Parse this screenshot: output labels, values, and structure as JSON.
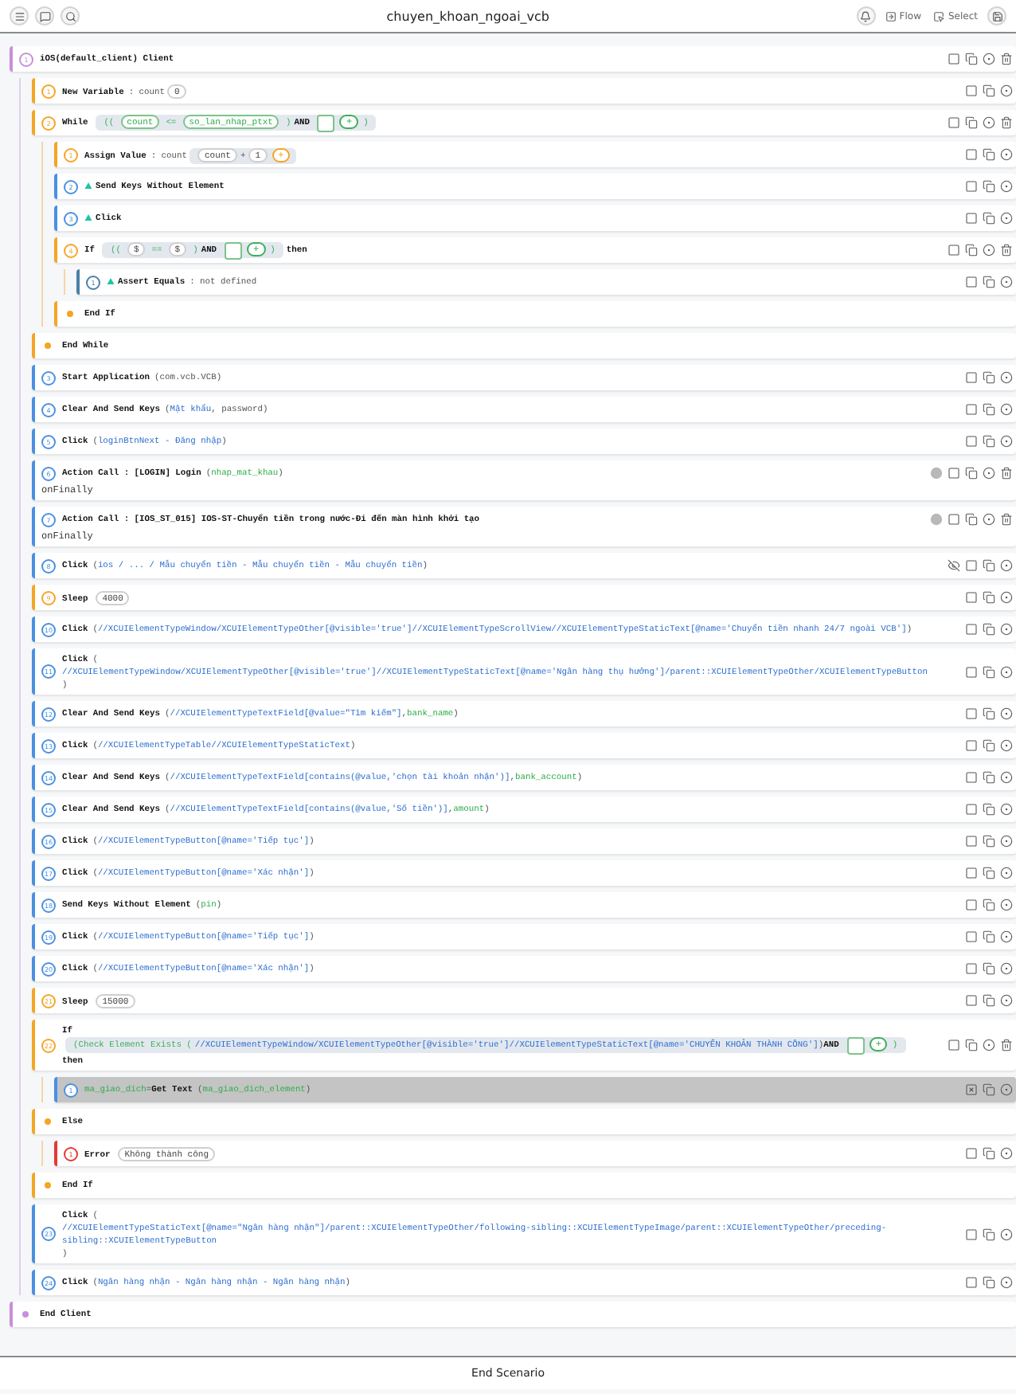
{
  "header": {
    "title": "chuyen_khoan_ngoai_vcb",
    "buttons": [
      {
        "label": "Flow"
      },
      {
        "label": "Select"
      }
    ]
  },
  "steps": [
    {
      "kind": "step",
      "number": "1",
      "color": "#c98fd9",
      "selected": false,
      "deletable": true,
      "parts": [
        {
          "kind": "label",
          "text": "iOS(default_client) Client"
        }
      ],
      "children": [
        {
          "kind": "step",
          "number": "1",
          "color": "#f5a524",
          "selected": false,
          "parts": [
            {
              "kind": "label",
              "text": "New Variable"
            },
            {
              "kind": "plain",
              "text": ": count"
            },
            {
              "kind": "chip",
              "text": "0"
            }
          ]
        },
        {
          "kind": "step",
          "number": "2",
          "color": "#f5a524",
          "selected": false,
          "deletable": true,
          "parts": [
            {
              "kind": "label",
              "text": "While"
            },
            {
              "kind": "cond",
              "parts": [
                {
                  "kind": "op",
                  "text": "(("
                },
                {
                  "kind": "varchip",
                  "text": "count"
                },
                {
                  "kind": "op",
                  "text": "<="
                },
                {
                  "kind": "varchip",
                  "text": "so_lan_nhap_ptxt"
                },
                {
                  "kind": "op",
                  "text": ")"
                },
                {
                  "kind": "label",
                  "text": "AND"
                },
                {
                  "kind": "slot"
                },
                {
                  "kind": "add",
                  "text": "+",
                  "color": "#3fae5a"
                },
                {
                  "kind": "op",
                  "text": ")"
                }
              ]
            }
          ],
          "children": [
            {
              "kind": "step",
              "number": "1",
              "color": "#f5a524",
              "selected": false,
              "parts": [
                {
                  "kind": "label",
                  "text": "Assign Value"
                },
                {
                  "kind": "plain",
                  "text": ": count"
                },
                {
                  "kind": "cond",
                  "parts": [
                    {
                      "kind": "chip",
                      "text": "count"
                    },
                    {
                      "kind": "plain",
                      "text": "+"
                    },
                    {
                      "kind": "chip",
                      "text": "1"
                    },
                    {
                      "kind": "add",
                      "text": "+",
                      "color": "#f5a524"
                    }
                  ]
                }
              ]
            },
            {
              "kind": "step",
              "number": "2",
              "color": "#4a90e2",
              "selected": false,
              "flag": true,
              "parts": [
                {
                  "kind": "label",
                  "text": "Send Keys Without Element"
                }
              ]
            },
            {
              "kind": "step",
              "number": "3",
              "color": "#4a90e2",
              "selected": false,
              "flag": true,
              "parts": [
                {
                  "kind": "label",
                  "text": "Click"
                }
              ]
            },
            {
              "kind": "step",
              "number": "4",
              "color": "#f5a524",
              "selected": false,
              "deletable": true,
              "parts": [
                {
                  "kind": "label",
                  "text": "If"
                },
                {
                  "kind": "cond",
                  "parts": [
                    {
                      "kind": "op",
                      "text": "(("
                    },
                    {
                      "kind": "chip",
                      "text": "$"
                    },
                    {
                      "kind": "op",
                      "text": "=="
                    },
                    {
                      "kind": "chip",
                      "text": "$"
                    },
                    {
                      "kind": "op",
                      "text": ")"
                    },
                    {
                      "kind": "label",
                      "text": "AND"
                    },
                    {
                      "kind": "slot"
                    },
                    {
                      "kind": "add",
                      "text": "+",
                      "color": "#3fae5a"
                    },
                    {
                      "kind": "op",
                      "text": ")"
                    }
                  ]
                },
                {
                  "kind": "label",
                  "text": "then"
                }
              ],
              "children": [
                {
                  "kind": "step",
                  "number": "1",
                  "color": "#4a7fa8",
                  "selected": false,
                  "flag": true,
                  "parts": [
                    {
                      "kind": "label",
                      "text": "Assert Equals"
                    },
                    {
                      "kind": "plain",
                      "text": ": not defined"
                    }
                  ]
                }
              ]
            },
            {
              "kind": "end",
              "color": "#f5a524",
              "text": "End If"
            }
          ]
        },
        {
          "kind": "end",
          "color": "#f5a524",
          "text": "End While"
        },
        {
          "kind": "step",
          "number": "3",
          "color": "#4a90e2",
          "selected": false,
          "parts": [
            {
              "kind": "label",
              "text": "Start Application"
            },
            {
              "kind": "plain",
              "text": "(com.vcb.VCB)"
            }
          ]
        },
        {
          "kind": "step",
          "number": "4",
          "color": "#4a90e2",
          "selected": false,
          "parts": [
            {
              "kind": "label",
              "text": "Clear And Send Keys"
            },
            {
              "kind": "plain",
              "text": "("
            },
            {
              "kind": "path",
              "text": "Mật khẩu"
            },
            {
              "kind": "plain",
              "text": ", password)"
            }
          ]
        },
        {
          "kind": "step",
          "number": "5",
          "color": "#4a90e2",
          "selected": false,
          "parts": [
            {
              "kind": "label",
              "text": "Click"
            },
            {
              "kind": "plain",
              "text": "("
            },
            {
              "kind": "path",
              "text": "loginBtnNext - Đăng nhập"
            },
            {
              "kind": "plain",
              "text": ")"
            }
          ]
        },
        {
          "kind": "step",
          "number": "6",
          "color": "#4a90e2",
          "selected": false,
          "linked": true,
          "deletable": true,
          "note": "onFinally",
          "parts": [
            {
              "kind": "label",
              "text": "Action Call : [LOGIN] Login"
            },
            {
              "kind": "plain",
              "text": "("
            },
            {
              "kind": "var",
              "text": "nhap_mat_khau"
            },
            {
              "kind": "plain",
              "text": ")"
            }
          ]
        },
        {
          "kind": "step",
          "number": "7",
          "color": "#4a90e2",
          "selected": false,
          "linked": true,
          "deletable": true,
          "note": "onFinally",
          "parts": [
            {
              "kind": "label",
              "text": "Action Call : [IOS_ST_015] IOS-ST-Chuyển tiền trong nước-Đi đến màn hình khởi tạo"
            }
          ]
        },
        {
          "kind": "step",
          "number": "8",
          "color": "#4a90e2",
          "selected": false,
          "muted": true,
          "parts": [
            {
              "kind": "label",
              "text": "Click"
            },
            {
              "kind": "plain",
              "text": "("
            },
            {
              "kind": "path",
              "text": "ios / ... / Mẫu chuyển tiền - Mẫu chuyển tiền - Mẫu chuyển tiền"
            },
            {
              "kind": "plain",
              "text": ")"
            }
          ]
        },
        {
          "kind": "step",
          "number": "9",
          "color": "#f5a524",
          "selected": false,
          "parts": [
            {
              "kind": "label",
              "text": "Sleep"
            },
            {
              "kind": "chip",
              "text": "4000"
            }
          ]
        },
        {
          "kind": "step",
          "number": "10",
          "color": "#4a90e2",
          "selected": false,
          "parts": [
            {
              "kind": "label",
              "text": "Click"
            },
            {
              "kind": "plain",
              "text": "("
            },
            {
              "kind": "path",
              "text": "//XCUIElementTypeWindow/XCUIElementTypeOther[@visible='true']//XCUIElementTypeScrollView//XCUIElementTypeStaticText[@name='Chuyển tiền nhanh 24/7 ngoài VCB']"
            },
            {
              "kind": "plain",
              "text": ")"
            }
          ]
        },
        {
          "kind": "step",
          "number": "11",
          "color": "#4a90e2",
          "selected": false,
          "parts": [
            {
              "kind": "label",
              "text": "Click"
            },
            {
              "kind": "plain",
              "text": "("
            },
            {
              "kind": "break"
            },
            {
              "kind": "path",
              "text": "//XCUIElementTypeWindow/XCUIElementTypeOther[@visible='true']//XCUIElementTypeStaticText[@name='Ngân hàng thụ hưởng']/parent::XCUIElementTypeOther/XCUIElementTypeButton"
            },
            {
              "kind": "break"
            },
            {
              "kind": "plain",
              "text": ")"
            }
          ]
        },
        {
          "kind": "step",
          "number": "12",
          "color": "#4a90e2",
          "selected": false,
          "parts": [
            {
              "kind": "label",
              "text": "Clear And Send Keys"
            },
            {
              "kind": "plain",
              "text": "("
            },
            {
              "kind": "path",
              "text": "//XCUIElementTypeTextField[@value=\"Tìm kiếm\"]"
            },
            {
              "kind": "plain",
              "text": ","
            },
            {
              "kind": "var",
              "text": "bank_name"
            },
            {
              "kind": "plain",
              "text": ")"
            }
          ]
        },
        {
          "kind": "step",
          "number": "13",
          "color": "#4a90e2",
          "selected": false,
          "parts": [
            {
              "kind": "label",
              "text": "Click"
            },
            {
              "kind": "plain",
              "text": "("
            },
            {
              "kind": "path",
              "text": "//XCUIElementTypeTable//XCUIElementTypeStaticText"
            },
            {
              "kind": "plain",
              "text": ")"
            }
          ]
        },
        {
          "kind": "step",
          "number": "14",
          "color": "#4a90e2",
          "selected": false,
          "parts": [
            {
              "kind": "label",
              "text": "Clear And Send Keys"
            },
            {
              "kind": "plain",
              "text": "("
            },
            {
              "kind": "path",
              "text": "//XCUIElementTypeTextField[contains(@value,'chọn tài khoản nhận')]"
            },
            {
              "kind": "plain",
              "text": ","
            },
            {
              "kind": "var",
              "text": "bank_account"
            },
            {
              "kind": "plain",
              "text": ")"
            }
          ]
        },
        {
          "kind": "step",
          "number": "15",
          "color": "#4a90e2",
          "selected": false,
          "parts": [
            {
              "kind": "label",
              "text": "Clear And Send Keys"
            },
            {
              "kind": "plain",
              "text": "("
            },
            {
              "kind": "path",
              "text": "//XCUIElementTypeTextField[contains(@value,'Số tiền')]"
            },
            {
              "kind": "plain",
              "text": ","
            },
            {
              "kind": "var",
              "text": "amount"
            },
            {
              "kind": "plain",
              "text": ")"
            }
          ]
        },
        {
          "kind": "step",
          "number": "16",
          "color": "#4a90e2",
          "selected": false,
          "parts": [
            {
              "kind": "label",
              "text": "Click"
            },
            {
              "kind": "plain",
              "text": "("
            },
            {
              "kind": "path",
              "text": "//XCUIElementTypeButton[@name='Tiếp tục']"
            },
            {
              "kind": "plain",
              "text": ")"
            }
          ]
        },
        {
          "kind": "step",
          "number": "17",
          "color": "#4a90e2",
          "selected": false,
          "parts": [
            {
              "kind": "label",
              "text": "Click"
            },
            {
              "kind": "plain",
              "text": "("
            },
            {
              "kind": "path",
              "text": "//XCUIElementTypeButton[@name='Xác nhận']"
            },
            {
              "kind": "plain",
              "text": ")"
            }
          ]
        },
        {
          "kind": "step",
          "number": "18",
          "color": "#4a90e2",
          "selected": false,
          "parts": [
            {
              "kind": "label",
              "text": "Send Keys Without Element"
            },
            {
              "kind": "plain",
              "text": "("
            },
            {
              "kind": "var",
              "text": "pin"
            },
            {
              "kind": "plain",
              "text": ")"
            }
          ]
        },
        {
          "kind": "step",
          "number": "19",
          "color": "#4a90e2",
          "selected": false,
          "parts": [
            {
              "kind": "label",
              "text": "Click"
            },
            {
              "kind": "plain",
              "text": "("
            },
            {
              "kind": "path",
              "text": "//XCUIElementTypeButton[@name='Tiếp tục']"
            },
            {
              "kind": "plain",
              "text": ")"
            }
          ]
        },
        {
          "kind": "step",
          "number": "20",
          "color": "#4a90e2",
          "selected": false,
          "parts": [
            {
              "kind": "label",
              "text": "Click"
            },
            {
              "kind": "plain",
              "text": "("
            },
            {
              "kind": "path",
              "text": "//XCUIElementTypeButton[@name='Xác nhận']"
            },
            {
              "kind": "plain",
              "text": ")"
            }
          ]
        },
        {
          "kind": "step",
          "number": "21",
          "color": "#f5a524",
          "selected": false,
          "parts": [
            {
              "kind": "label",
              "text": "Sleep"
            },
            {
              "kind": "chip",
              "text": "15000"
            }
          ]
        },
        {
          "kind": "step",
          "number": "22",
          "color": "#f5a524",
          "selected": false,
          "deletable": true,
          "parts": [
            {
              "kind": "label",
              "text": "If"
            },
            {
              "kind": "break"
            },
            {
              "kind": "cond",
              "parts": [
                {
                  "kind": "op",
                  "text": "(Check Element Exists ("
                },
                {
                  "kind": "path",
                  "text": "//XCUIElementTypeWindow/XCUIElementTypeOther[@visible='true']//XCUIElementTypeStaticText[@name='CHUYỂN KHOẢN THÀNH CÔNG']"
                },
                {
                  "kind": "plain",
                  "text": ")"
                },
                {
                  "kind": "label",
                  "text": "AND"
                },
                {
                  "kind": "slot"
                },
                {
                  "kind": "add",
                  "text": "+",
                  "color": "#3fae5a"
                },
                {
                  "kind": "op",
                  "text": ")"
                }
              ]
            },
            {
              "kind": "break"
            },
            {
              "kind": "label",
              "text": "then"
            }
          ],
          "children": [
            {
              "kind": "step",
              "number": "1",
              "color": "#4a90e2",
              "selected": true,
              "parts": [
                {
                  "kind": "var",
                  "text": "ma_giao_dich"
                },
                {
                  "kind": "plain",
                  "text": "="
                },
                {
                  "kind": "label",
                  "text": "Get Text"
                },
                {
                  "kind": "plain",
                  "text": "("
                },
                {
                  "kind": "var",
                  "text": "ma_giao_dich_element"
                },
                {
                  "kind": "plain",
                  "text": ")"
                }
              ]
            }
          ]
        },
        {
          "kind": "end",
          "color": "#f5a524",
          "text": "Else",
          "children": [
            {
              "kind": "step",
              "number": "1",
              "color": "#e53935",
              "selected": false,
              "parts": [
                {
                  "kind": "label",
                  "text": "Error"
                },
                {
                  "kind": "chip",
                  "text": "Không thành công"
                }
              ]
            }
          ]
        },
        {
          "kind": "end",
          "color": "#f5a524",
          "text": "End If"
        },
        {
          "kind": "step",
          "number": "23",
          "color": "#4a90e2",
          "selected": false,
          "parts": [
            {
              "kind": "label",
              "text": "Click"
            },
            {
              "kind": "plain",
              "text": "("
            },
            {
              "kind": "break"
            },
            {
              "kind": "path",
              "text": "//XCUIElementTypeStaticText[@name=\"Ngân hàng nhận\"]/parent::XCUIElementTypeOther/following-sibling::XCUIElementTypeImage/parent::XCUIElementTypeOther/preceding-sibling::XCUIElementTypeButton"
            },
            {
              "kind": "break"
            },
            {
              "kind": "plain",
              "text": ")"
            }
          ]
        },
        {
          "kind": "step",
          "number": "24",
          "color": "#4a90e2",
          "selected": false,
          "parts": [
            {
              "kind": "label",
              "text": "Click"
            },
            {
              "kind": "plain",
              "text": "("
            },
            {
              "kind": "path",
              "text": "Ngân hàng nhận - Ngân hàng nhận - Ngân hàng nhận"
            },
            {
              "kind": "plain",
              "text": ")"
            }
          ]
        }
      ]
    },
    {
      "kind": "end",
      "color": "#c98fd9",
      "text": "End Client"
    }
  ],
  "footer": {
    "label": "End Scenario"
  }
}
